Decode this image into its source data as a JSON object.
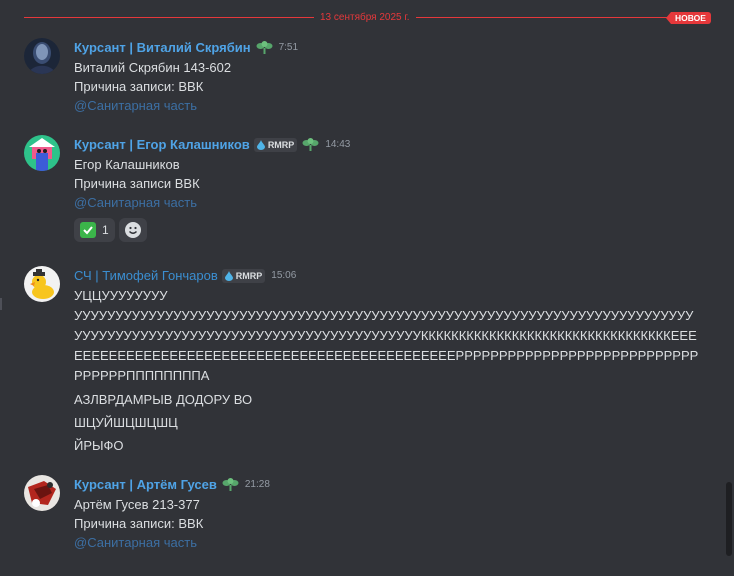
{
  "divider": {
    "date": "13 сентября 2025 г.",
    "badge": "НОВОЕ"
  },
  "messages": [
    {
      "author": "Курсант | Виталий Скрябин",
      "time": "7:51",
      "lines": [
        "Виталий Скрябин 143-602",
        "Причина записи: ВВК"
      ],
      "mention": "@Санитарная часть"
    },
    {
      "author": "Курсант |  Егор Калашников",
      "tag": "RMRP",
      "time": "14:43",
      "lines": [
        "Егор Калашников",
        "Причина записи ВВК"
      ],
      "mention": "@Санитарная часть",
      "reaction_count": "1"
    },
    {
      "author": "СЧ | Тимофей Гончаров",
      "tag": "RMRP",
      "time": "15:06",
      "lines": [
        "УЦЦУУУУУУУУ",
        "УУУУУУУУУУУУУУУУУУУУУУУУУУУУУУУУУУУУУУУУУУУУУУУУУУУУУУУУУУУУУУУУУУУУУУУУУУУУУУУУУУУУУУУУУУУУУУУУУУУУУУУУУУУУУУУУУУУУУКККККККККККККККККККККККККККККККККЕЕЕЕЕЕЕЕЕЕЕЕЕЕЕЕЕЕЕЕЕЕЕЕЕЕЕЕЕЕЕЕЕЕЕЕЕЕЕЕЕЕЕЕЕЕЕРРРРРРРРРРРРРРРРРРРРРРРРРРРРРРРРРРППППППППА",
        "АЗЛВРДАМРЫВ ДОДОРУ ВО",
        "ШЦУЙШЦШЦШЦ",
        "ЙРЫФО"
      ]
    },
    {
      "author": "Курсант | Артём Гусев",
      "time": "21:28",
      "lines": [
        "Артём Гусев 213-377",
        "Причина записи: ВВК"
      ],
      "mention": "@Санитарная часть"
    }
  ],
  "colors": {
    "accent_red": "#e5383b",
    "author_blue": "#4fa3e6",
    "background": "#313338"
  }
}
